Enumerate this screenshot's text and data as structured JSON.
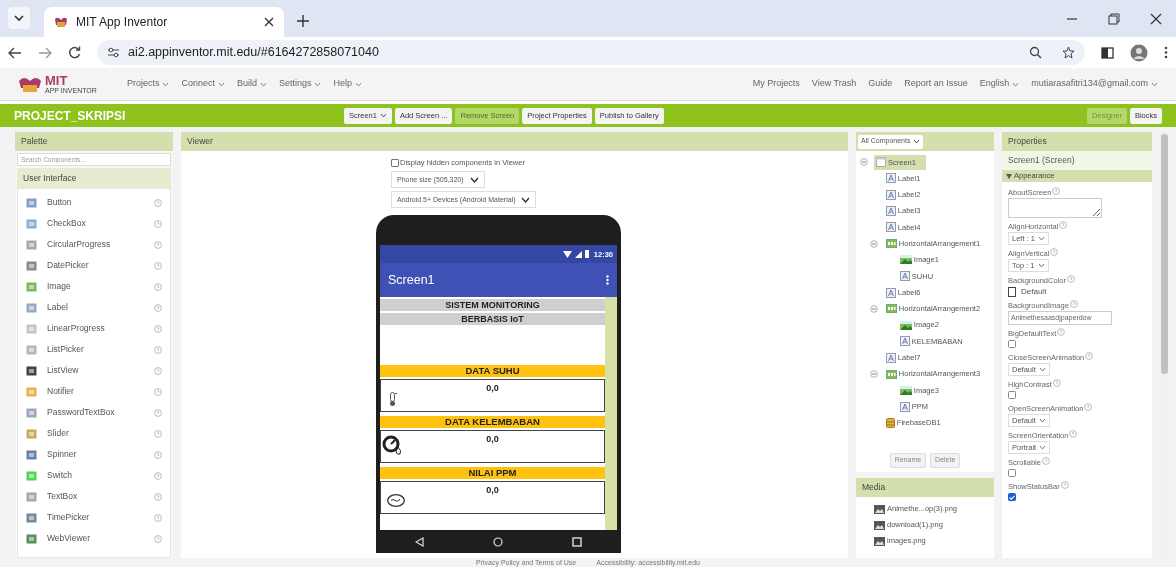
{
  "browser": {
    "tab_title": "MIT App Inventor",
    "url": "ai2.appinventor.mit.edu/#6164272858071040"
  },
  "header": {
    "logo_text": "MIT",
    "logo_subtext": "APP INVENTOR",
    "menus": [
      "Projects",
      "Connect",
      "Build",
      "Settings",
      "Help"
    ],
    "links": [
      {
        "label": "My Projects",
        "dropdown": false
      },
      {
        "label": "View Trash",
        "dropdown": false
      },
      {
        "label": "Guide",
        "dropdown": false
      },
      {
        "label": "Report an Issue",
        "dropdown": false
      },
      {
        "label": "English",
        "dropdown": true
      },
      {
        "label": "mutiarasafitri134@gmail.com",
        "dropdown": true
      }
    ]
  },
  "toolbar": {
    "project": "PROJECT_SKRIPSI",
    "buttons": [
      {
        "label": "Screen1",
        "dropdown": true,
        "disabled": false
      },
      {
        "label": "Add Screen ...",
        "dropdown": false,
        "disabled": false
      },
      {
        "label": "Remove Screen",
        "dropdown": false,
        "disabled": true
      },
      {
        "label": "Project Properties",
        "dropdown": false,
        "disabled": false
      },
      {
        "label": "Publish to Gallery",
        "dropdown": false,
        "disabled": false
      }
    ],
    "views": [
      {
        "label": "Designer",
        "selected": true
      },
      {
        "label": "Blocks",
        "selected": false
      }
    ]
  },
  "palette": {
    "title": "Palette",
    "search_placeholder": "Search Components...",
    "section": "User Interface",
    "items": [
      "Button",
      "CheckBox",
      "CircularProgress",
      "DatePicker",
      "Image",
      "Label",
      "LinearProgress",
      "ListPicker",
      "ListView",
      "Notifier",
      "PasswordTextBox",
      "Slider",
      "Spinner",
      "Switch",
      "TextBox",
      "TimePicker",
      "WebViewer"
    ]
  },
  "viewer": {
    "title": "Viewer",
    "show_hidden": {
      "label": "Display hidden components in Viewer",
      "checked": false
    },
    "dropdowns": [
      "Phone size (505,320)",
      "Android 5+ Devices (Android Material)"
    ],
    "phone": {
      "time": "12:30",
      "title": "Screen1",
      "items": [
        {
          "kind": "title",
          "text": "SISTEM MONITORING"
        },
        {
          "kind": "title",
          "text": "BERBASIS IoT"
        },
        {
          "kind": "header",
          "text": "DATA SUHU"
        },
        {
          "kind": "reading",
          "text": "0,0"
        },
        {
          "kind": "header",
          "text": "DATA KELEMBABAN"
        },
        {
          "kind": "reading",
          "text": "0,0"
        },
        {
          "kind": "header",
          "text": "NILAI PPM"
        },
        {
          "kind": "reading",
          "text": "0,0"
        }
      ]
    }
  },
  "components": {
    "filter": "All Components",
    "tree": [
      {
        "name": "Screen1",
        "kind": "screen",
        "selected": true,
        "expanded": true,
        "children": [
          {
            "name": "Label1",
            "kind": "label",
            "selected": false
          },
          {
            "name": "Label2",
            "kind": "label",
            "selected": false
          },
          {
            "name": "Label3",
            "kind": "label",
            "selected": false
          },
          {
            "name": "Label4",
            "kind": "label",
            "selected": false
          },
          {
            "name": "HorizontalArrangement1",
            "kind": "arrangement",
            "selected": false,
            "expanded": true,
            "children": [
              {
                "name": "Image1",
                "kind": "image",
                "selected": false
              },
              {
                "name": "SUHU",
                "kind": "label",
                "selected": false
              }
            ]
          },
          {
            "name": "Label6",
            "kind": "label",
            "selected": false
          },
          {
            "name": "HorizontalArrangement2",
            "kind": "arrangement",
            "selected": false,
            "expanded": true,
            "children": [
              {
                "name": "Image2",
                "kind": "image",
                "selected": false
              },
              {
                "name": "KELEMBABAN",
                "kind": "label",
                "selected": false
              }
            ]
          },
          {
            "name": "Label7",
            "kind": "label",
            "selected": false
          },
          {
            "name": "HorizontalArrangement3",
            "kind": "arrangement",
            "selected": false,
            "expanded": true,
            "children": [
              {
                "name": "Image3",
                "kind": "image",
                "selected": false
              },
              {
                "name": "PPM",
                "kind": "label",
                "selected": false
              }
            ]
          },
          {
            "name": "FirebaseDB1",
            "kind": "database",
            "selected": false
          }
        ]
      }
    ],
    "buttons": [
      {
        "label": "Rename",
        "disabled": true
      },
      {
        "label": "Delete",
        "disabled": true
      }
    ]
  },
  "media": {
    "title": "Media",
    "files": [
      "Animethe...op(3).png",
      "download(1).png",
      "images.png"
    ]
  },
  "properties": {
    "title": "Properties",
    "subject": "Screen1 (Screen)",
    "group": {
      "label": "Appearance",
      "expanded": true
    },
    "items": [
      {
        "label": "AboutScreen",
        "kind": "textarea"
      },
      {
        "label": "AlignHorizontal",
        "kind": "select",
        "value": "Left : 1"
      },
      {
        "label": "AlignVertical",
        "kind": "select",
        "value": "Top : 1"
      },
      {
        "label": "BackgroundColor",
        "kind": "color",
        "value": "Default"
      },
      {
        "label": "BackgroundImage",
        "kind": "text",
        "value": "Animethesaasdjpaperdow"
      },
      {
        "label": "BigDefaultText",
        "kind": "checkbox",
        "checked": false
      },
      {
        "label": "CloseScreenAnimation",
        "kind": "select",
        "value": "Default"
      },
      {
        "label": "HighContrast",
        "kind": "checkbox",
        "checked": false
      },
      {
        "label": "OpenScreenAnimation",
        "kind": "select",
        "value": "Default"
      },
      {
        "label": "ScreenOrientation",
        "kind": "select",
        "value": "Portrait"
      },
      {
        "label": "Scrollable",
        "kind": "checkbox",
        "checked": false
      },
      {
        "label": "ShowStatusBar",
        "kind": "checkbox",
        "checked": true
      }
    ]
  },
  "footer": [
    "Privacy Policy and Terms of Use",
    "Accessibility: accessibility.mit.edu"
  ]
}
